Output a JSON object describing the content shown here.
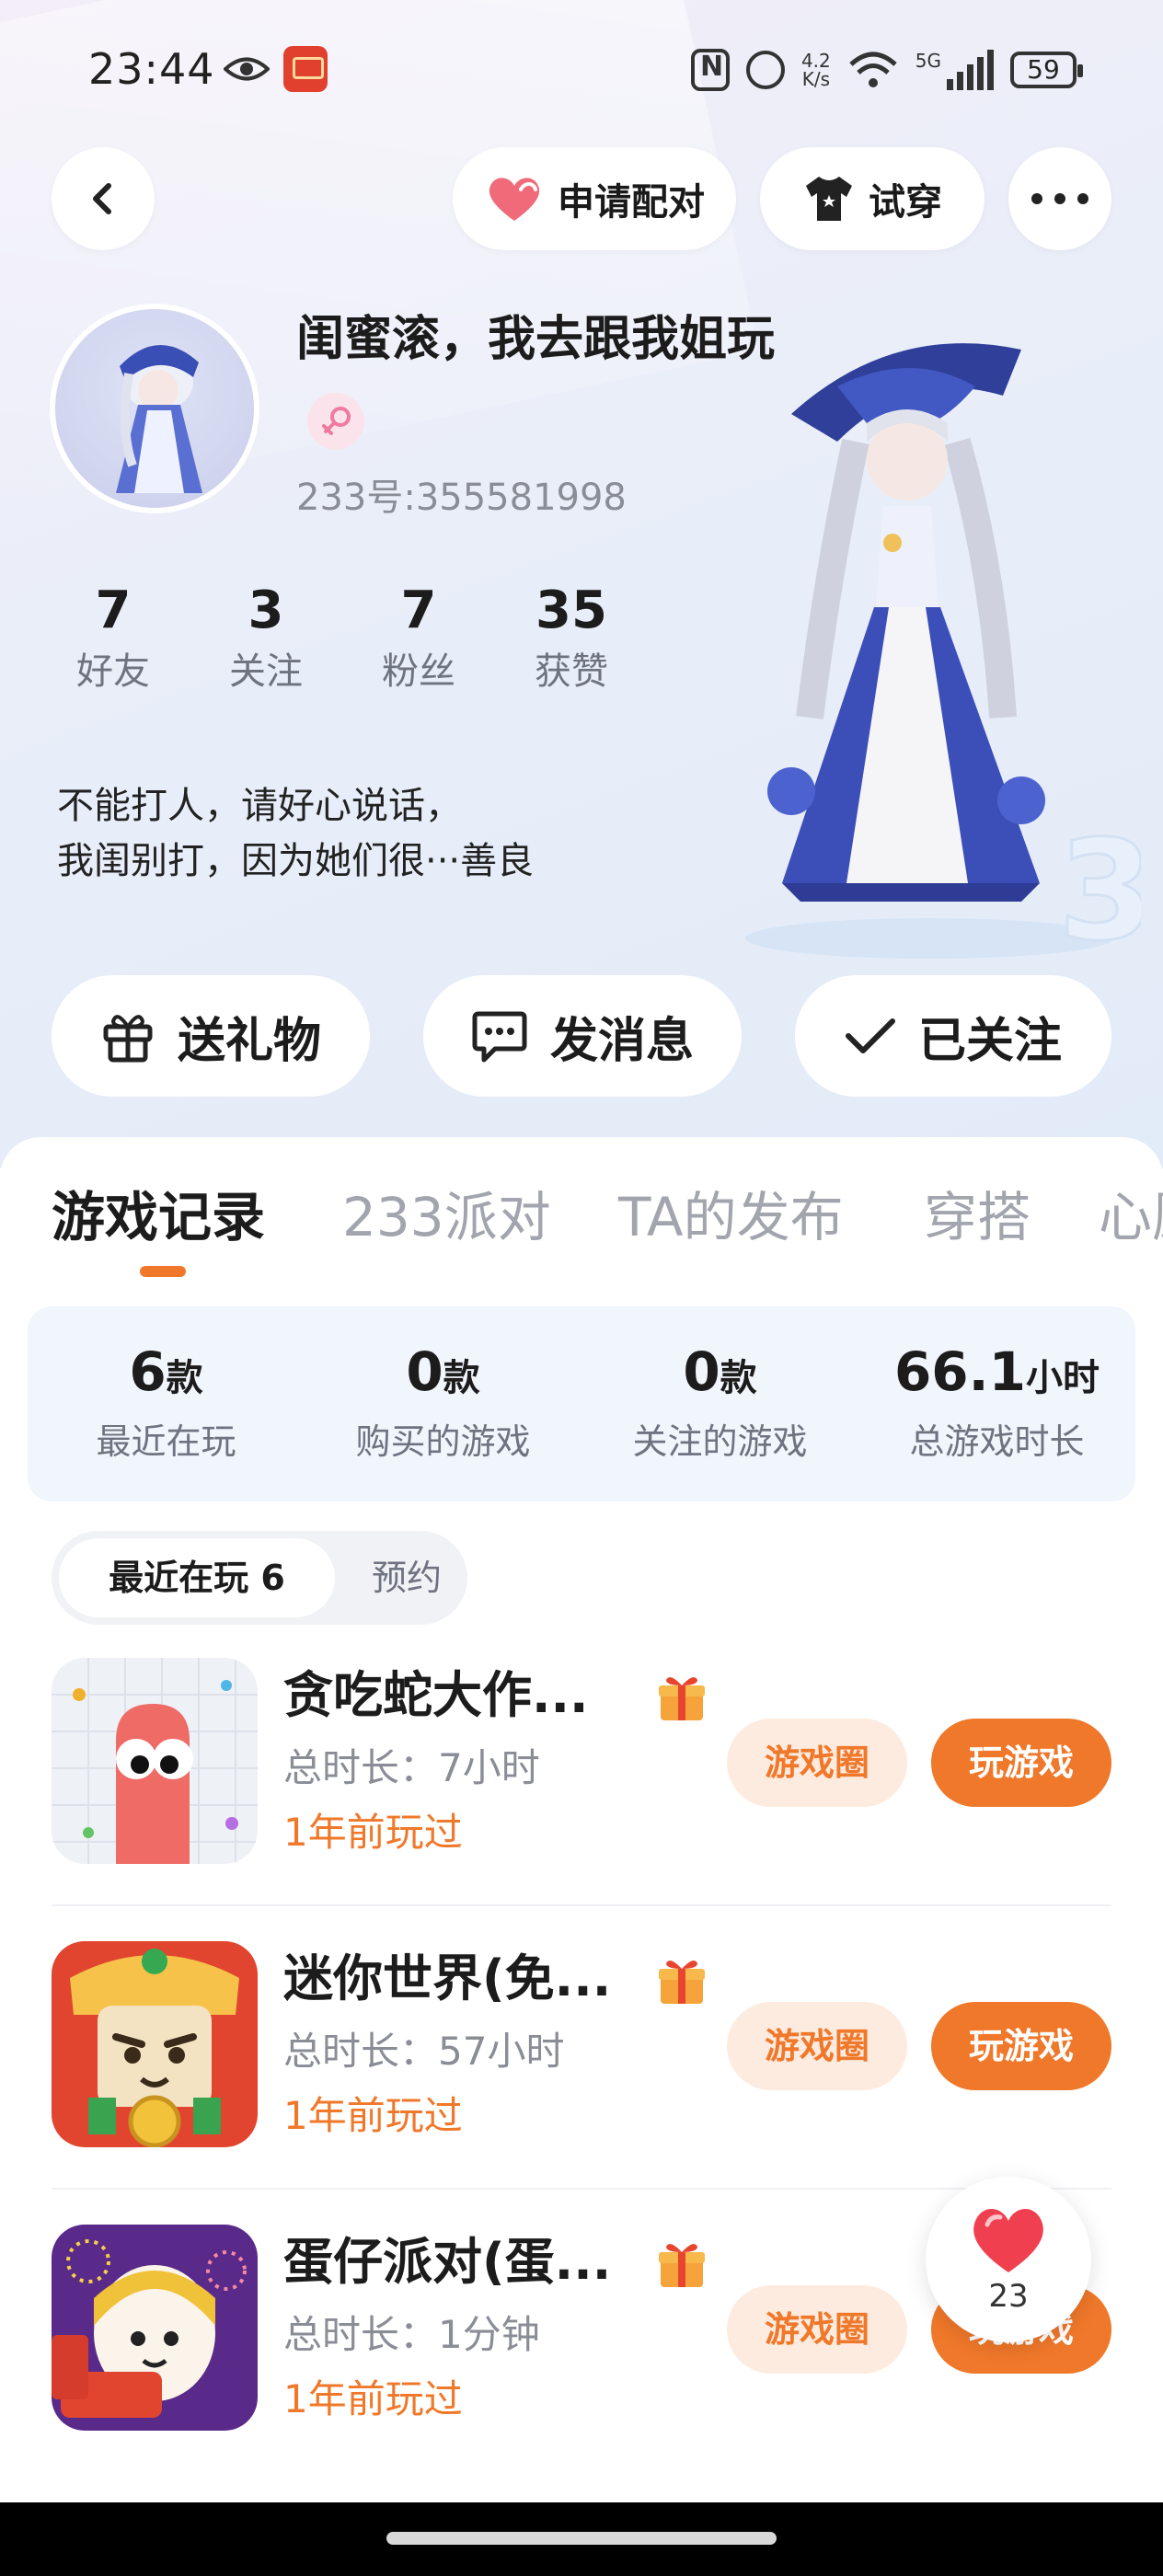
{
  "status_bar": {
    "time": "23:44",
    "speed_top": "4.2",
    "speed_bottom": "K/s",
    "network": "5G",
    "battery": "59",
    "icons": [
      "eye-icon",
      "app-badge-icon",
      "nfc-icon",
      "alarm-icon",
      "wifi-icon",
      "signal-icon",
      "battery-icon"
    ]
  },
  "top_bar": {
    "pair_label": "申请配对",
    "tryon_label": "试穿",
    "icons": [
      "back-arrow-icon",
      "heart-icon",
      "tshirt-icon",
      "more-dots-icon"
    ]
  },
  "profile": {
    "name": "闺蜜滚，我去跟我姐玩",
    "uid": "233号:355581998",
    "gender": "female",
    "stats": [
      {
        "value": "7",
        "label": "好友"
      },
      {
        "value": "3",
        "label": "关注"
      },
      {
        "value": "7",
        "label": "粉丝"
      },
      {
        "value": "35",
        "label": "获赞"
      }
    ],
    "bio_line1": "不能打人，请好心说话，",
    "bio_line2": "我闺别打，因为她们很···善良"
  },
  "actions": {
    "gift": "送礼物",
    "message": "发消息",
    "follow": "已关注"
  },
  "tabs": [
    {
      "label": "游戏记录",
      "active": true
    },
    {
      "label": "233派对",
      "active": false
    },
    {
      "label": "TA的发布",
      "active": false
    },
    {
      "label": "穿搭",
      "active": false
    },
    {
      "label": "心愿",
      "active": false
    }
  ],
  "summary": [
    {
      "value": "6",
      "unit": "款",
      "label": "最近在玩"
    },
    {
      "value": "0",
      "unit": "款",
      "label": "购买的游戏"
    },
    {
      "value": "0",
      "unit": "款",
      "label": "关注的游戏"
    },
    {
      "value": "66.1",
      "unit": "小时",
      "label": "总游戏时长"
    }
  ],
  "segments": {
    "recent": "最近在玩 6",
    "reserve": "预约"
  },
  "games": [
    {
      "title": "贪吃蛇大作...",
      "duration": "总时长：7小时",
      "last_played": "1年前玩过",
      "circle": "游戏圈",
      "play": "玩游戏"
    },
    {
      "title": "迷你世界(免...",
      "duration": "总时长：57小时",
      "last_played": "1年前玩过",
      "circle": "游戏圈",
      "play": "玩游戏"
    },
    {
      "title": "蛋仔派对(蛋...",
      "duration": "总时长：1分钟",
      "last_played": "1年前玩过",
      "circle": "游戏圈",
      "play": "玩游戏"
    }
  ],
  "like_float": {
    "count": "23"
  },
  "colors": {
    "accent": "#f0782a",
    "accent_light": "#fdebe0",
    "heart": "#f06a7a"
  }
}
